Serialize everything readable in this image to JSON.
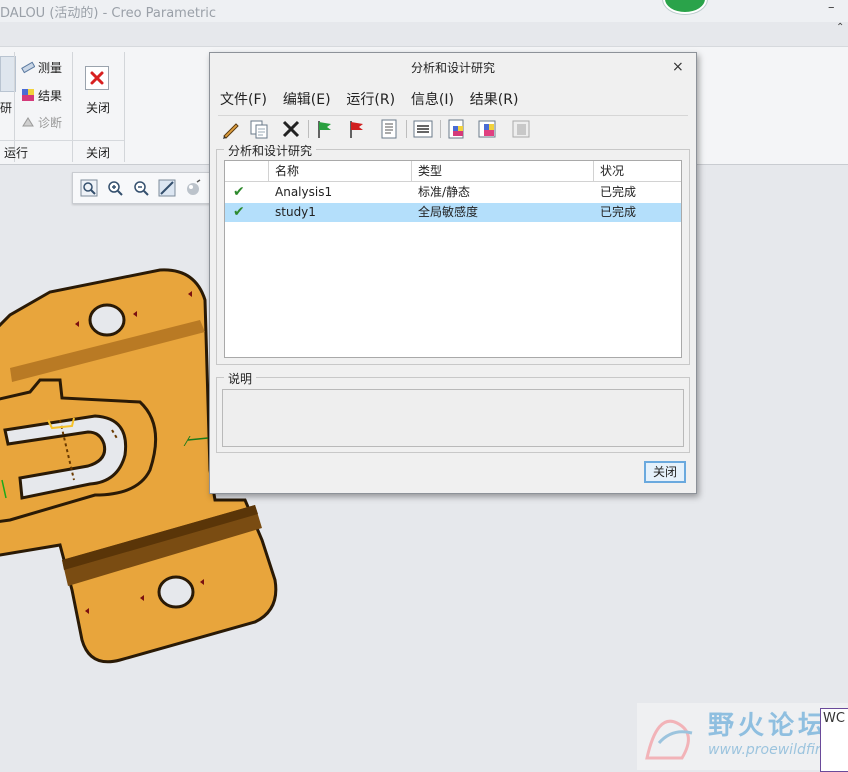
{
  "window": {
    "title": "DALOU (活动的) - Creo Parametric",
    "minimize_glyph": "–",
    "ribbon_collapse_glyph": "⌃"
  },
  "ribbon": {
    "run_button_label": "研",
    "measure_label": "测量",
    "results_label": "结果",
    "diagnose_label": "诊断",
    "close_label": "关闭",
    "groups": {
      "run": "运行",
      "close": "关闭"
    }
  },
  "view_toolbar": {
    "icons": [
      "zoom-fit-icon",
      "zoom-in-icon",
      "zoom-out-icon",
      "repaint-icon",
      "display-style-icon"
    ]
  },
  "dialog": {
    "title": "分析和设计研究",
    "close_glyph": "×",
    "menus": [
      "文件(F)",
      "编辑(E)",
      "运行(R)",
      "信息(I)",
      "结果(R)"
    ],
    "toolbar_icons": [
      "edit-icon",
      "copy-icon",
      "delete-icon",
      "start-flag-icon",
      "stop-flag-icon",
      "status-list-icon",
      "summary-icon",
      "review-results-icon",
      "insert-result-icon",
      "copy-result-icon"
    ],
    "studies_group_label": "分析和设计研究",
    "columns": [
      "名称",
      "类型",
      "状况"
    ],
    "rows": [
      {
        "status_icon": "check-icon",
        "name": "Analysis1",
        "type": "标准/静态",
        "state": "已完成",
        "selected": false
      },
      {
        "status_icon": "check-icon",
        "name": "study1",
        "type": "全局敏感度",
        "state": "已完成",
        "selected": true
      }
    ],
    "description_group_label": "说明",
    "description_text": "",
    "close_button": "关闭"
  },
  "colors": {
    "part_fill": "#e8a53c",
    "part_shade": "#9c6418",
    "selection_highlight": "#b4dffb",
    "arrow": "#e8241c"
  },
  "watermark": {
    "text": "野火论坛",
    "url": "www.proewildfire.cn"
  },
  "coordinate_label": "WC"
}
